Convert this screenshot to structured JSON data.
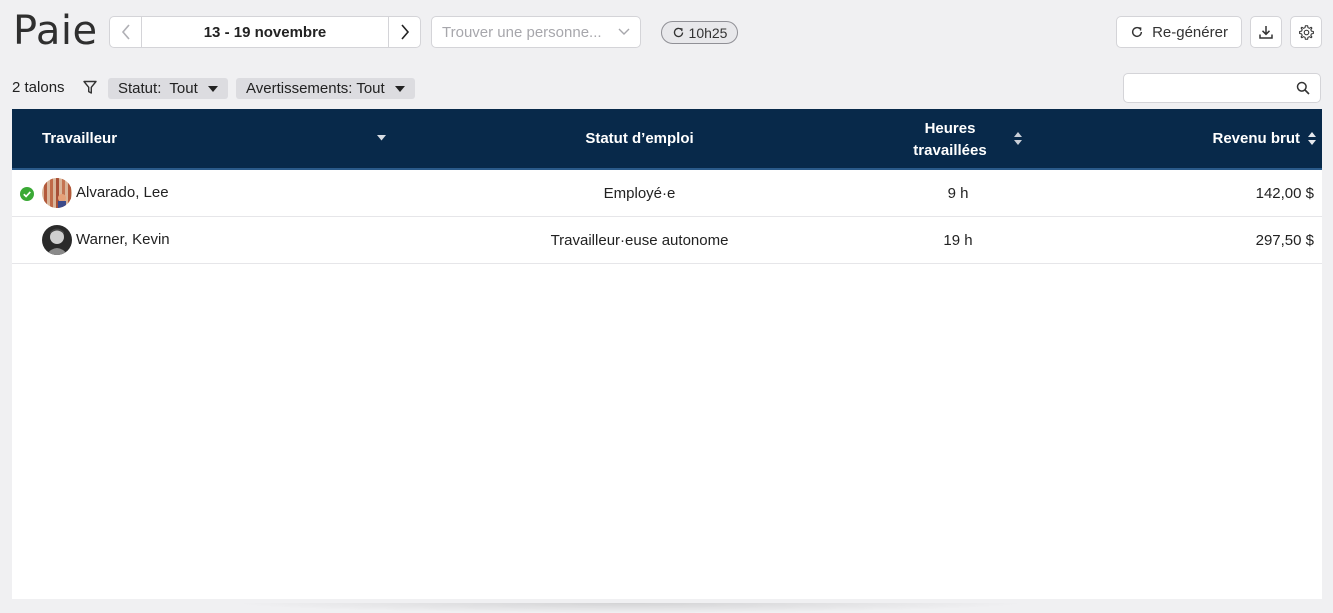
{
  "header": {
    "title": "Paie",
    "date_range": "13 - 19 novembre",
    "person_placeholder": "Trouver une personne...",
    "sync_time": "10h25",
    "regenerate_label": "Re-générer"
  },
  "filters": {
    "count_label": "2 talons",
    "status_chip": "Statut:  Tout",
    "warnings_chip": "Avertissements: Tout",
    "search_placeholder": ""
  },
  "table": {
    "columns": {
      "worker": "Travailleur",
      "employment_status": "Statut d’emploi",
      "hours_line1": "Heures",
      "hours_line2": "travaillées",
      "gross": "Revenu brut"
    },
    "rows": [
      {
        "name": "Alvarado, Lee",
        "status": "Employé·e",
        "hours": "9 h",
        "gross": "142,00 $",
        "verified": true
      },
      {
        "name": "Warner, Kevin",
        "status": "Travailleur·euse autonome",
        "hours": "19 h",
        "gross": "297,50 $",
        "verified": false
      }
    ]
  },
  "colors": {
    "header_bg": "#08294a",
    "check_green": "#3aa935",
    "page_bg": "#f0f0f2"
  },
  "icons": {
    "prev": "chevron-left-icon",
    "next": "chevron-right-icon",
    "dropdown": "chevron-down-icon",
    "sync": "refresh-icon",
    "regenerate": "refresh-icon",
    "download": "download-icon",
    "settings": "gear-icon",
    "filter": "filter-icon",
    "search": "search-icon",
    "sort": "sort-icon",
    "verified": "check-circle-icon"
  }
}
